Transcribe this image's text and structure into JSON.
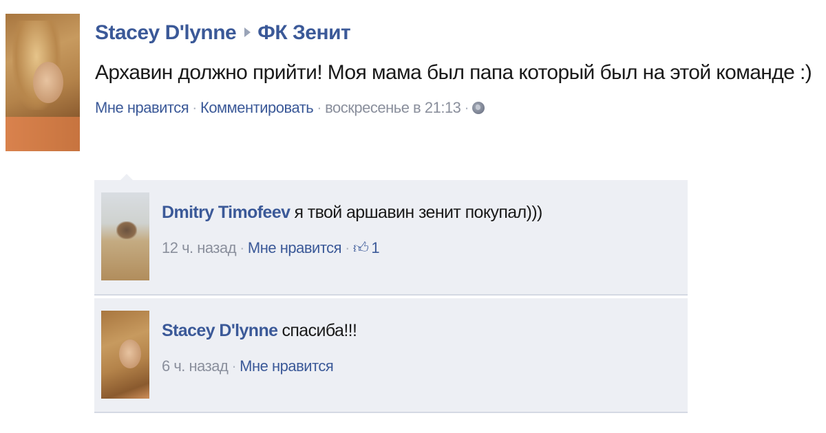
{
  "post": {
    "author": "Stacey D'lynne",
    "target": "ФК Зенит",
    "text": "Архавин должно прийти! Моя мама был папа который был на этой команде :)",
    "meta": {
      "like": "Мне нравится",
      "comment": "Комментировать",
      "time": "воскресенье в 21:13",
      "separator": "·"
    },
    "icons": {
      "arrow": "arrow-right-icon",
      "privacy": "globe-icon"
    }
  },
  "comments": [
    {
      "author": "Dmitry Timofeev",
      "text": "я твой аршавин зенит покупал)))",
      "time": "12 ч. назад",
      "like": "Мне нравится",
      "like_count": "1",
      "icon": "thumbs-up-icon"
    },
    {
      "author": "Stacey D'lynne",
      "text": "спасиба!!!",
      "time": "6 ч. назад",
      "like": "Мне нравится"
    }
  ],
  "colors": {
    "link": "#3b5998",
    "meta": "#8a8f9c",
    "comment_bg": "#edeff4",
    "text": "#1a1a1a"
  }
}
